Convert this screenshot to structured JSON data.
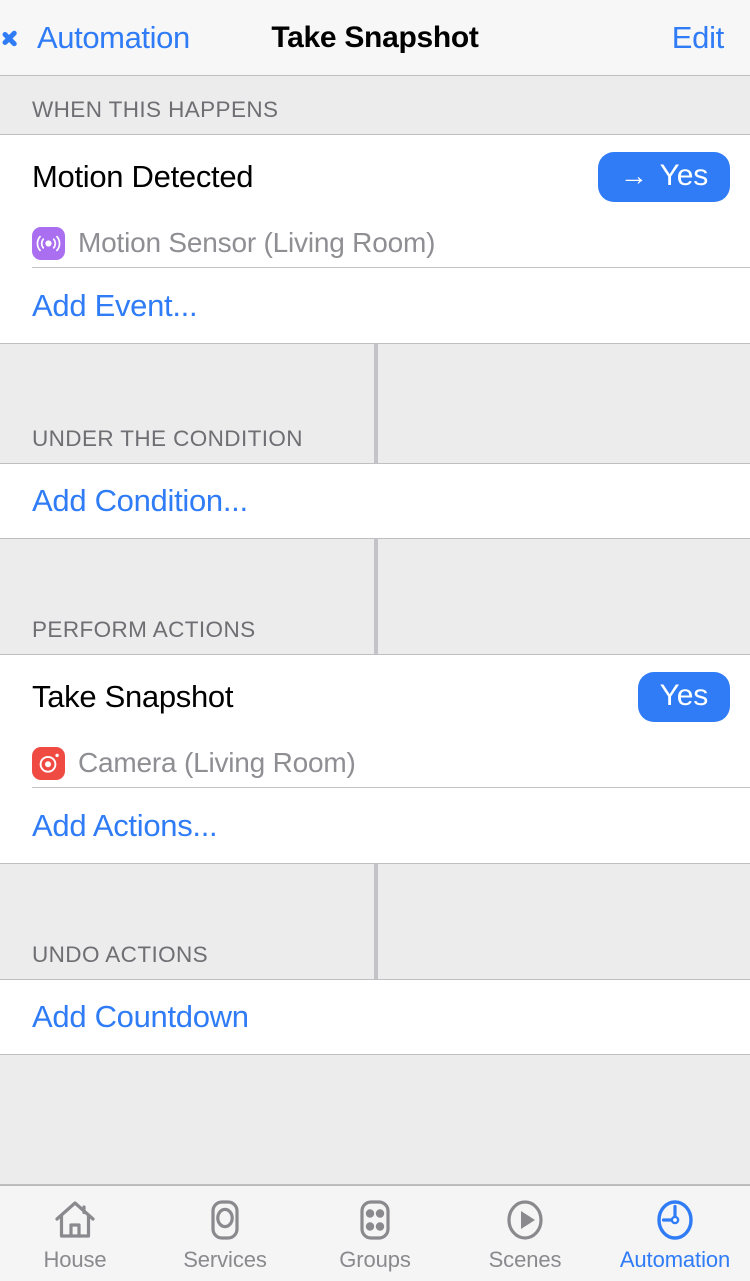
{
  "navbar": {
    "back_label": "Automation",
    "back_icon": "chevron-left-icon",
    "title": "Take Snapshot",
    "edit_label": "Edit"
  },
  "colors": {
    "accent": "#2f7cf6",
    "section_bg": "#ececed",
    "row_bg": "#ffffff",
    "separator": "#c3c3c8",
    "secondary_text": "#8e8e93",
    "header_text": "#6e6e73",
    "motion_sensor_icon": "#a96ff0",
    "camera_icon": "#ef4b43"
  },
  "sections": [
    {
      "header": "WHEN THIS HAPPENS",
      "has_vertical_divider": false,
      "item": {
        "title": "Motion Detected",
        "pill_label": "Yes",
        "pill_arrow": "→",
        "pill_has_arrow": true,
        "accessory_icon": "motion-sensor-icon",
        "accessory_label": "Motion Sensor (Living Room)"
      },
      "link": "Add Event..."
    },
    {
      "header": "UNDER THE CONDITION",
      "has_vertical_divider": true,
      "item": null,
      "link": "Add Condition..."
    },
    {
      "header": "PERFORM ACTIONS",
      "has_vertical_divider": true,
      "item": {
        "title": "Take Snapshot",
        "pill_label": "Yes",
        "pill_arrow": "",
        "pill_has_arrow": false,
        "accessory_icon": "camera-icon",
        "accessory_label": "Camera (Living Room)"
      },
      "link": "Add Actions..."
    },
    {
      "header": "UNDO ACTIONS",
      "has_vertical_divider": true,
      "item": null,
      "link": "Add Countdown"
    }
  ],
  "tabbar": {
    "tabs": [
      {
        "label": "House",
        "icon": "house-icon",
        "active": false
      },
      {
        "label": "Services",
        "icon": "services-icon",
        "active": false
      },
      {
        "label": "Groups",
        "icon": "groups-icon",
        "active": false
      },
      {
        "label": "Scenes",
        "icon": "scenes-play-icon",
        "active": false
      },
      {
        "label": "Automation",
        "icon": "clock-icon",
        "active": true
      }
    ]
  }
}
